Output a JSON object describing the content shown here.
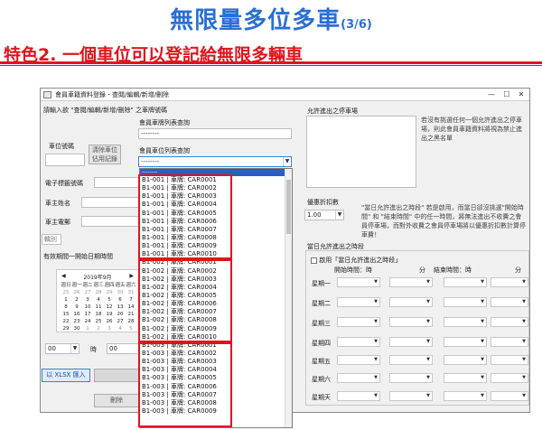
{
  "slide": {
    "title": "無限量多位多車",
    "title_suffix": "(3/6)",
    "subtitle": "特色2.  一個車位可以登記給無限多輛車"
  },
  "window": {
    "title": "會員車籍資料登錄 - 查閱/編輯/新增/刪除",
    "minimize": "—",
    "maximize": "☐",
    "close": "✕"
  },
  "form": {
    "search_hint": "請輸入欲  \"查閱/編輯/新增/刪除\"  之車牌號碼",
    "plate_list_label": "會員車牌列表查詢",
    "plate_list_value": "--------",
    "slot_list_label": "會員車位列表查詢",
    "slot_list_value": "--------",
    "slot_no_label": "車位號碼",
    "clear_slot_button": "清除車位佔用記錄",
    "tag_no_label": "電子標籤號碼",
    "owner_name_label": "車主姓名",
    "owner_phone_label": "車主電郵",
    "category_value": "轎別",
    "period_label": "有效期間一開始日期時間",
    "hour_value": "00",
    "hour_unit": "時",
    "minute_value": "00",
    "import_button": "以 XLSX 匯入",
    "delete_button": "刪除"
  },
  "calendar": {
    "month": "2019年9月",
    "weekdays": [
      "週日",
      "週一",
      "週二",
      "週三",
      "週四",
      "週五",
      "週六"
    ],
    "rows": [
      [
        "25",
        "26",
        "27",
        "28",
        "29",
        "30",
        "31"
      ],
      [
        "1",
        "2",
        "3",
        "4",
        "5",
        "6",
        "7"
      ],
      [
        "8",
        "9",
        "10",
        "11",
        "12",
        "13",
        "14"
      ],
      [
        "15",
        "16",
        "17",
        "18",
        "19",
        "20",
        "21"
      ],
      [
        "22",
        "23",
        "24",
        "25",
        "26",
        "27",
        "28"
      ],
      [
        "29",
        "30",
        "1",
        "2",
        "3",
        "4",
        "5"
      ]
    ]
  },
  "slot_dropdown": {
    "selected": "--------",
    "items": [
      "B1-001 | 車牌: CAR0001",
      "B1-001 | 車牌: CAR0002",
      "B1-001 | 車牌: CAR0003",
      "B1-001 | 車牌: CAR0004",
      "B1-001 | 車牌: CAR0005",
      "B1-001 | 車牌: CAR0006",
      "B1-001 | 車牌: CAR0007",
      "B1-001 | 車牌: CAR0008",
      "B1-001 | 車牌: CAR0009",
      "B1-001 | 車牌: CAR0010",
      "B1-002 | 車牌: CAR0001",
      "B1-002 | 車牌: CAR0002",
      "B1-002 | 車牌: CAR0003",
      "B1-002 | 車牌: CAR0004",
      "B1-002 | 車牌: CAR0005",
      "B1-002 | 車牌: CAR0006",
      "B1-002 | 車牌: CAR0007",
      "B1-002 | 車牌: CAR0008",
      "B1-002 | 車牌: CAR0009",
      "B1-002 | 車牌: CAR0010",
      "B1-003 | 車牌: CAR0001",
      "B1-003 | 車牌: CAR0002",
      "B1-003 | 車牌: CAR0003",
      "B1-003 | 車牌: CAR0004",
      "B1-003 | 車牌: CAR0005",
      "B1-003 | 車牌: CAR0006",
      "B1-003 | 車牌: CAR0007",
      "B1-003 | 車牌: CAR0008",
      "B1-003 | 車牌: CAR0009"
    ]
  },
  "right": {
    "allowed_label": "允許進出之停車場",
    "allowed_note": "若沒有挑選任何一個允許進出之停車場，則此會員車籍資料將視為禁止進出之黑名單",
    "discount_label": "優惠折扣數",
    "discount_value": "1.00",
    "discount_note": "\"當日允許進出之時段\" 若是啟用，而當日卻沒挑選\"開始時間\" 和 \"結束時間\" 中的任一時間，將無法進出不收費之會員停車場，而對外收費之會員停車場將以優惠折扣數計算停車費！",
    "period_label": "當日允許進出之時段",
    "enable_label": "啟用「當日允許進出之時段」",
    "start_label": "開始時間：時",
    "minute_label": "分",
    "end_label": "結束時間：時",
    "end_minute_label": "分",
    "days": [
      "星期一",
      "星期二",
      "星期三",
      "星期四",
      "星期五",
      "星期六",
      "星期天"
    ]
  }
}
